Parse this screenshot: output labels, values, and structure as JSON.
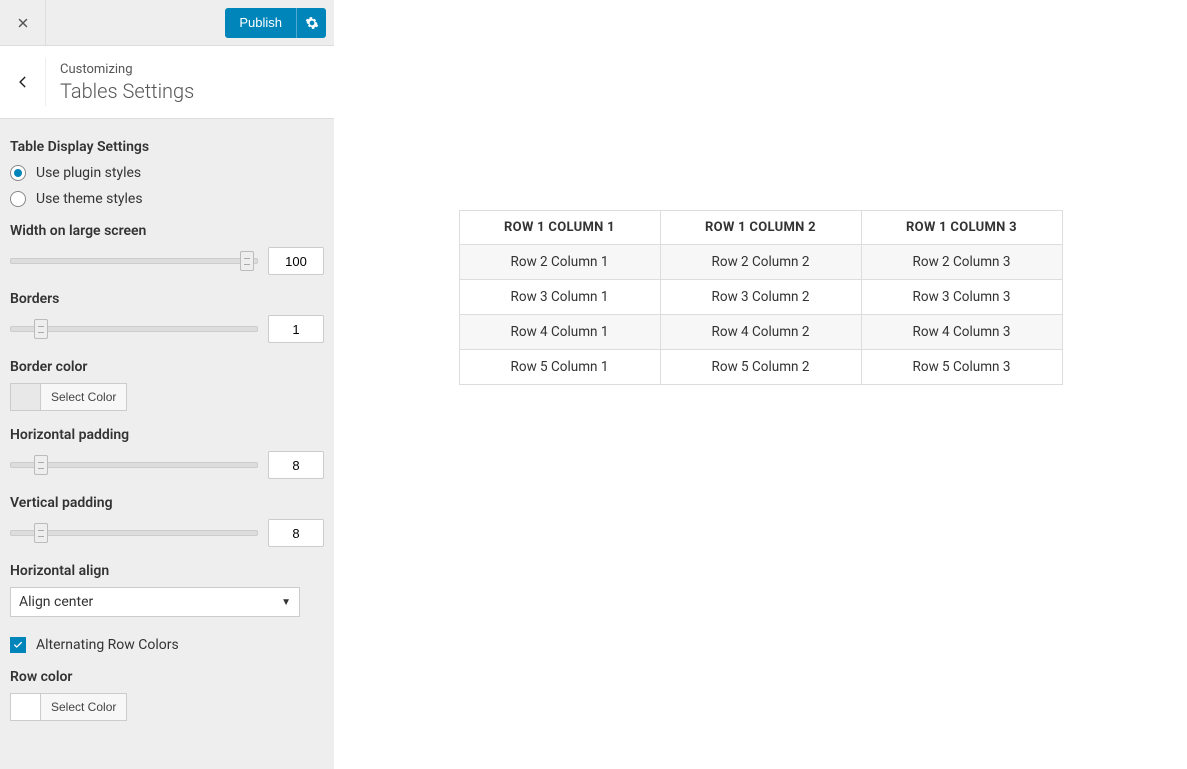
{
  "topbar": {
    "publish_label": "Publish"
  },
  "header": {
    "breadcrumb": "Customizing",
    "title": "Tables Settings"
  },
  "panel": {
    "display_settings_heading": "Table Display Settings",
    "style_options": [
      {
        "label": "Use plugin styles",
        "checked": true
      },
      {
        "label": "Use theme styles",
        "checked": false
      }
    ],
    "width_label": "Width on large screen",
    "width_value": "100",
    "width_pos_pct": 96,
    "borders_label": "Borders",
    "borders_value": "1",
    "borders_pos_pct": 12,
    "border_color_label": "Border color",
    "border_color_btn": "Select Color",
    "hpad_label": "Horizontal padding",
    "hpad_value": "8",
    "hpad_pos_pct": 12,
    "vpad_label": "Vertical padding",
    "vpad_value": "8",
    "vpad_pos_pct": 12,
    "halign_label": "Horizontal align",
    "halign_value": "Align center",
    "alt_rows_label": "Alternating Row Colors",
    "alt_rows_checked": true,
    "row_color_label": "Row color",
    "row_color_btn": "Select Color"
  },
  "table": {
    "headers": [
      "ROW 1 COLUMN 1",
      "ROW 1 COLUMN 2",
      "ROW 1 COLUMN 3"
    ],
    "rows": [
      [
        "Row 2 Column 1",
        "Row 2 Column 2",
        "Row 2 Column 3"
      ],
      [
        "Row 3 Column 1",
        "Row 3 Column 2",
        "Row 3 Column 3"
      ],
      [
        "Row 4 Column 1",
        "Row 4 Column 2",
        "Row 4 Column 3"
      ],
      [
        "Row 5 Column 1",
        "Row 5 Column 2",
        "Row 5 Column 3"
      ]
    ]
  }
}
